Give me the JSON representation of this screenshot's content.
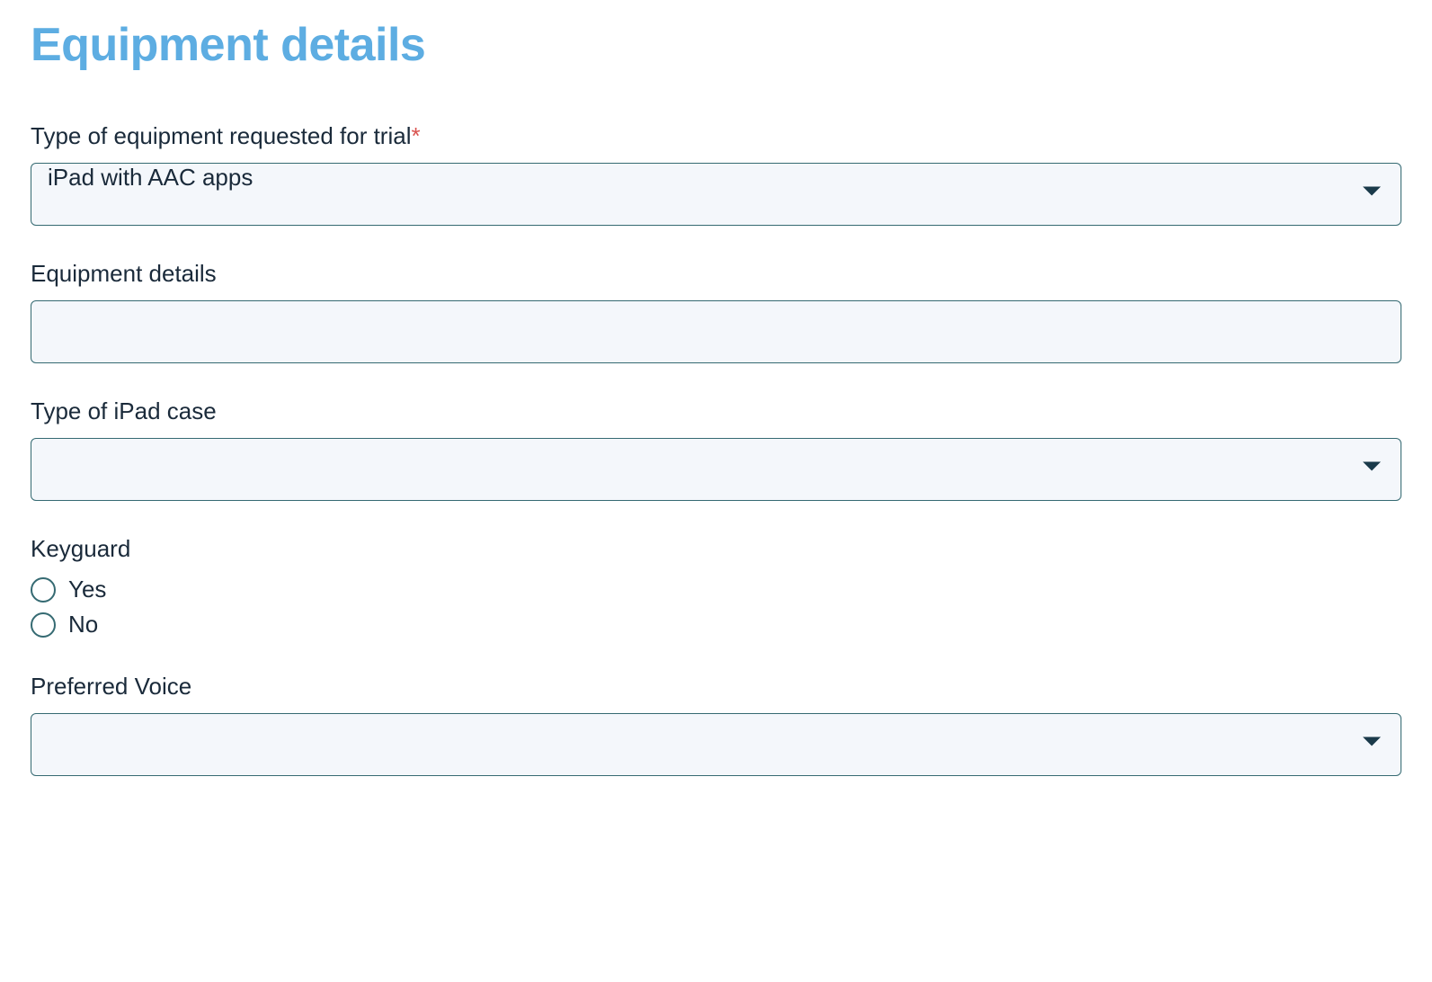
{
  "heading": "Equipment details",
  "required_mark": "*",
  "fields": {
    "equipment_type": {
      "label": "Type of equipment requested for trial",
      "value": "iPad with AAC apps"
    },
    "equipment_details": {
      "label": "Equipment details",
      "value": ""
    },
    "ipad_case": {
      "label": "Type of iPad case",
      "value": ""
    },
    "keyguard": {
      "label": "Keyguard",
      "options": {
        "yes": "Yes",
        "no": "No"
      }
    },
    "preferred_voice": {
      "label": "Preferred Voice",
      "value": ""
    }
  }
}
